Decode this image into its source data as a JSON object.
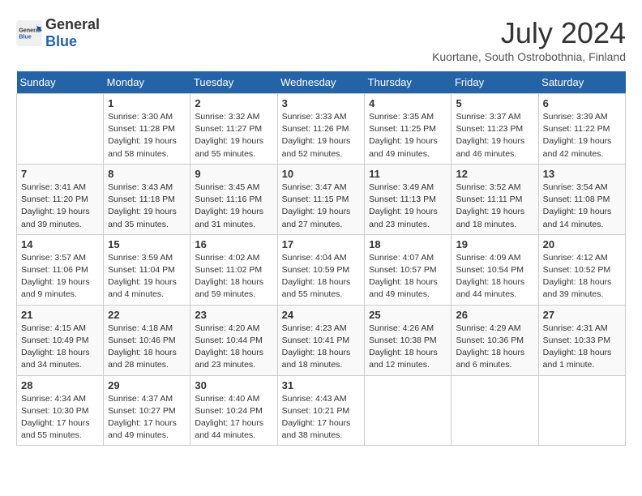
{
  "header": {
    "logo_general": "General",
    "logo_blue": "Blue",
    "month": "July 2024",
    "location": "Kuortane, South Ostrobothnia, Finland"
  },
  "weekdays": [
    "Sunday",
    "Monday",
    "Tuesday",
    "Wednesday",
    "Thursday",
    "Friday",
    "Saturday"
  ],
  "weeks": [
    [
      {
        "day": "",
        "detail": ""
      },
      {
        "day": "1",
        "detail": "Sunrise: 3:30 AM\nSunset: 11:28 PM\nDaylight: 19 hours\nand 58 minutes."
      },
      {
        "day": "2",
        "detail": "Sunrise: 3:32 AM\nSunset: 11:27 PM\nDaylight: 19 hours\nand 55 minutes."
      },
      {
        "day": "3",
        "detail": "Sunrise: 3:33 AM\nSunset: 11:26 PM\nDaylight: 19 hours\nand 52 minutes."
      },
      {
        "day": "4",
        "detail": "Sunrise: 3:35 AM\nSunset: 11:25 PM\nDaylight: 19 hours\nand 49 minutes."
      },
      {
        "day": "5",
        "detail": "Sunrise: 3:37 AM\nSunset: 11:23 PM\nDaylight: 19 hours\nand 46 minutes."
      },
      {
        "day": "6",
        "detail": "Sunrise: 3:39 AM\nSunset: 11:22 PM\nDaylight: 19 hours\nand 42 minutes."
      }
    ],
    [
      {
        "day": "7",
        "detail": "Sunrise: 3:41 AM\nSunset: 11:20 PM\nDaylight: 19 hours\nand 39 minutes."
      },
      {
        "day": "8",
        "detail": "Sunrise: 3:43 AM\nSunset: 11:18 PM\nDaylight: 19 hours\nand 35 minutes."
      },
      {
        "day": "9",
        "detail": "Sunrise: 3:45 AM\nSunset: 11:16 PM\nDaylight: 19 hours\nand 31 minutes."
      },
      {
        "day": "10",
        "detail": "Sunrise: 3:47 AM\nSunset: 11:15 PM\nDaylight: 19 hours\nand 27 minutes."
      },
      {
        "day": "11",
        "detail": "Sunrise: 3:49 AM\nSunset: 11:13 PM\nDaylight: 19 hours\nand 23 minutes."
      },
      {
        "day": "12",
        "detail": "Sunrise: 3:52 AM\nSunset: 11:11 PM\nDaylight: 19 hours\nand 18 minutes."
      },
      {
        "day": "13",
        "detail": "Sunrise: 3:54 AM\nSunset: 11:08 PM\nDaylight: 19 hours\nand 14 minutes."
      }
    ],
    [
      {
        "day": "14",
        "detail": "Sunrise: 3:57 AM\nSunset: 11:06 PM\nDaylight: 19 hours\nand 9 minutes."
      },
      {
        "day": "15",
        "detail": "Sunrise: 3:59 AM\nSunset: 11:04 PM\nDaylight: 19 hours\nand 4 minutes."
      },
      {
        "day": "16",
        "detail": "Sunrise: 4:02 AM\nSunset: 11:02 PM\nDaylight: 18 hours\nand 59 minutes."
      },
      {
        "day": "17",
        "detail": "Sunrise: 4:04 AM\nSunset: 10:59 PM\nDaylight: 18 hours\nand 55 minutes."
      },
      {
        "day": "18",
        "detail": "Sunrise: 4:07 AM\nSunset: 10:57 PM\nDaylight: 18 hours\nand 49 minutes."
      },
      {
        "day": "19",
        "detail": "Sunrise: 4:09 AM\nSunset: 10:54 PM\nDaylight: 18 hours\nand 44 minutes."
      },
      {
        "day": "20",
        "detail": "Sunrise: 4:12 AM\nSunset: 10:52 PM\nDaylight: 18 hours\nand 39 minutes."
      }
    ],
    [
      {
        "day": "21",
        "detail": "Sunrise: 4:15 AM\nSunset: 10:49 PM\nDaylight: 18 hours\nand 34 minutes."
      },
      {
        "day": "22",
        "detail": "Sunrise: 4:18 AM\nSunset: 10:46 PM\nDaylight: 18 hours\nand 28 minutes."
      },
      {
        "day": "23",
        "detail": "Sunrise: 4:20 AM\nSunset: 10:44 PM\nDaylight: 18 hours\nand 23 minutes."
      },
      {
        "day": "24",
        "detail": "Sunrise: 4:23 AM\nSunset: 10:41 PM\nDaylight: 18 hours\nand 18 minutes."
      },
      {
        "day": "25",
        "detail": "Sunrise: 4:26 AM\nSunset: 10:38 PM\nDaylight: 18 hours\nand 12 minutes."
      },
      {
        "day": "26",
        "detail": "Sunrise: 4:29 AM\nSunset: 10:36 PM\nDaylight: 18 hours\nand 6 minutes."
      },
      {
        "day": "27",
        "detail": "Sunrise: 4:31 AM\nSunset: 10:33 PM\nDaylight: 18 hours\nand 1 minute."
      }
    ],
    [
      {
        "day": "28",
        "detail": "Sunrise: 4:34 AM\nSunset: 10:30 PM\nDaylight: 17 hours\nand 55 minutes."
      },
      {
        "day": "29",
        "detail": "Sunrise: 4:37 AM\nSunset: 10:27 PM\nDaylight: 17 hours\nand 49 minutes."
      },
      {
        "day": "30",
        "detail": "Sunrise: 4:40 AM\nSunset: 10:24 PM\nDaylight: 17 hours\nand 44 minutes."
      },
      {
        "day": "31",
        "detail": "Sunrise: 4:43 AM\nSunset: 10:21 PM\nDaylight: 17 hours\nand 38 minutes."
      },
      {
        "day": "",
        "detail": ""
      },
      {
        "day": "",
        "detail": ""
      },
      {
        "day": "",
        "detail": ""
      }
    ]
  ]
}
